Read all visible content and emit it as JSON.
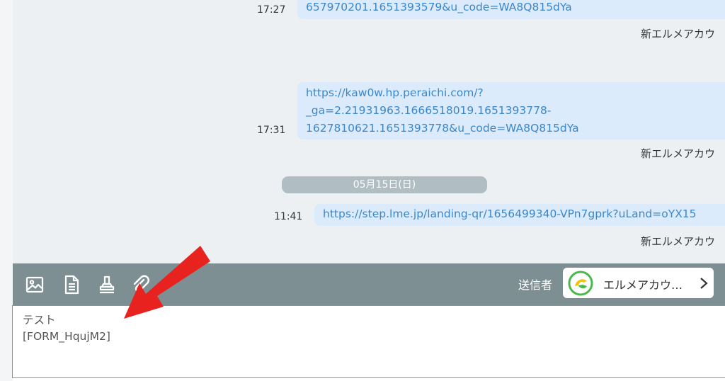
{
  "messages": [
    {
      "time": "17:27",
      "lines": [
        "657970201.1651393579&u_code=WA8Q815dYa"
      ],
      "sender": "新エルメアカウ"
    },
    {
      "time": "17:31",
      "lines": [
        "https://kaw0w.hp.peraichi.com/?",
        "_ga=2.21931963.1666518019.1651393778-",
        "1627810621.1651393778&u_code=WA8Q815dYa"
      ],
      "sender": "新エルメアカウ"
    },
    {
      "time": "11:41",
      "lines": [
        "https://step.lme.jp/landing-qr/1656499340-VPn7gprk?uLand=oYX15"
      ],
      "sender": "新エルメアカウ"
    }
  ],
  "date_divider": "05月15日(日)",
  "toolbar": {
    "icons": [
      "image-icon",
      "document-icon",
      "stamp-icon",
      "paperclip-icon"
    ],
    "sender_label": "送信者",
    "sender_name": "エルメアカウ…",
    "colors": {
      "toolbar_bg": "#7d8f92",
      "bubble_bg": "#dcebfb",
      "link": "#3b87c9",
      "arrow": "#e8231f"
    }
  },
  "compose": {
    "lines": [
      "テスト",
      "[FORM_HqujM2]"
    ]
  }
}
